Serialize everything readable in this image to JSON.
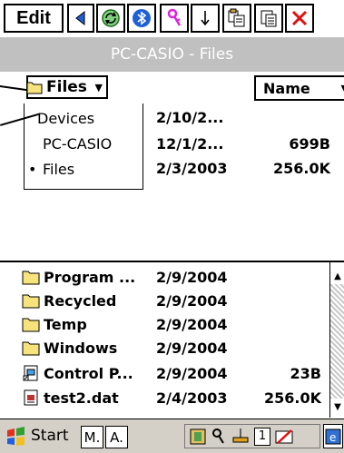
{
  "toolbar": {
    "edit_label": "Edit",
    "icons": [
      "back-icon",
      "sync-icon",
      "bluetooth-icon",
      "key-icon",
      "arrow-down-icon",
      "copy-icon",
      "paste-icon",
      "delete-icon"
    ]
  },
  "title": "PC-CASIO - Files",
  "header": {
    "folder_dropdown": "Files",
    "sort_column": "Name"
  },
  "location_menu": [
    {
      "label": "Devices",
      "selected": false
    },
    {
      "label": "PC-CASIO",
      "selected": false
    },
    {
      "label": "Files",
      "selected": true
    }
  ],
  "upper_rows": [
    {
      "date": "2/10/2...",
      "size": ""
    },
    {
      "date": "12/1/2...",
      "size": "699B"
    },
    {
      "date": "2/3/2003",
      "size": "256.0K"
    }
  ],
  "files": [
    {
      "name": "Program ...",
      "date": "2/9/2004",
      "size": "",
      "icon": "folder-icon"
    },
    {
      "name": "Recycled",
      "date": "2/9/2004",
      "size": "",
      "icon": "folder-icon"
    },
    {
      "name": "Temp",
      "date": "2/9/2004",
      "size": "",
      "icon": "folder-icon"
    },
    {
      "name": "Windows",
      "date": "2/9/2004",
      "size": "",
      "icon": "folder-icon"
    },
    {
      "name": "Control P...",
      "date": "2/9/2004",
      "size": "23B",
      "icon": "shortcut-icon"
    },
    {
      "name": "test2.dat",
      "date": "2/4/2003",
      "size": "256.0K",
      "icon": "file-icon"
    }
  ],
  "taskbar": {
    "start_label": "Start",
    "tasks": [
      "M.",
      "A."
    ],
    "tray_number": "1"
  },
  "colors": {
    "title_bar": "#c0c0c0",
    "taskbar": "#d4d0c8",
    "folder": "#f7e37b"
  }
}
